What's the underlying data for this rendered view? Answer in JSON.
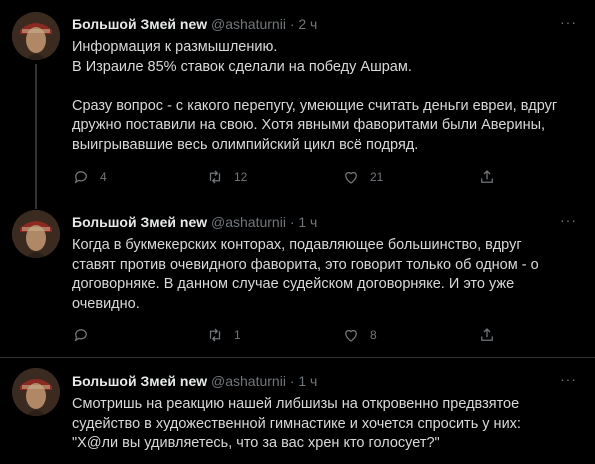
{
  "tweets": [
    {
      "name": "Большой Змей new",
      "handle": "@ashaturnii",
      "time": "· 2 ч",
      "more": "···",
      "lines": [
        "Информация к размышлению.",
        "В Израиле 85% ставок сделали на победу Ашрам.",
        "",
        "Сразу вопрос - с какого перепугу, умеющие считать деньги евреи, вдруг",
        "дружно поставили на свою. Хотя явными фаворитами были Аверины,",
        "выигрывавшие весь олимпийский цикл всё подряд."
      ],
      "reply_count": "4",
      "retweet_count": "12",
      "like_count": "21"
    },
    {
      "name": "Большой Змей new",
      "handle": "@ashaturnii",
      "time": "· 1 ч",
      "more": "···",
      "lines": [
        "Когда в букмекерских конторах, подавляющее большинство, вдруг",
        "ставят против очевидного фаворита, это говорит только об одном - о",
        "договорняке. В данном случае судейском договорняке. И это уже",
        "очевидно."
      ],
      "reply_count": "",
      "retweet_count": "1",
      "like_count": "8"
    },
    {
      "name": "Большой Змей new",
      "handle": "@ashaturnii",
      "time": "· 1 ч",
      "more": "···",
      "lines": [
        "Смотришь на реакцию нашей либшизы на откровенно предвзятое",
        "судейство в художественной гимнастике и хочется спросить у них:",
        "\"Х@ли вы удивляетесь, что за вас хрен кто голосует?\""
      ]
    }
  ]
}
